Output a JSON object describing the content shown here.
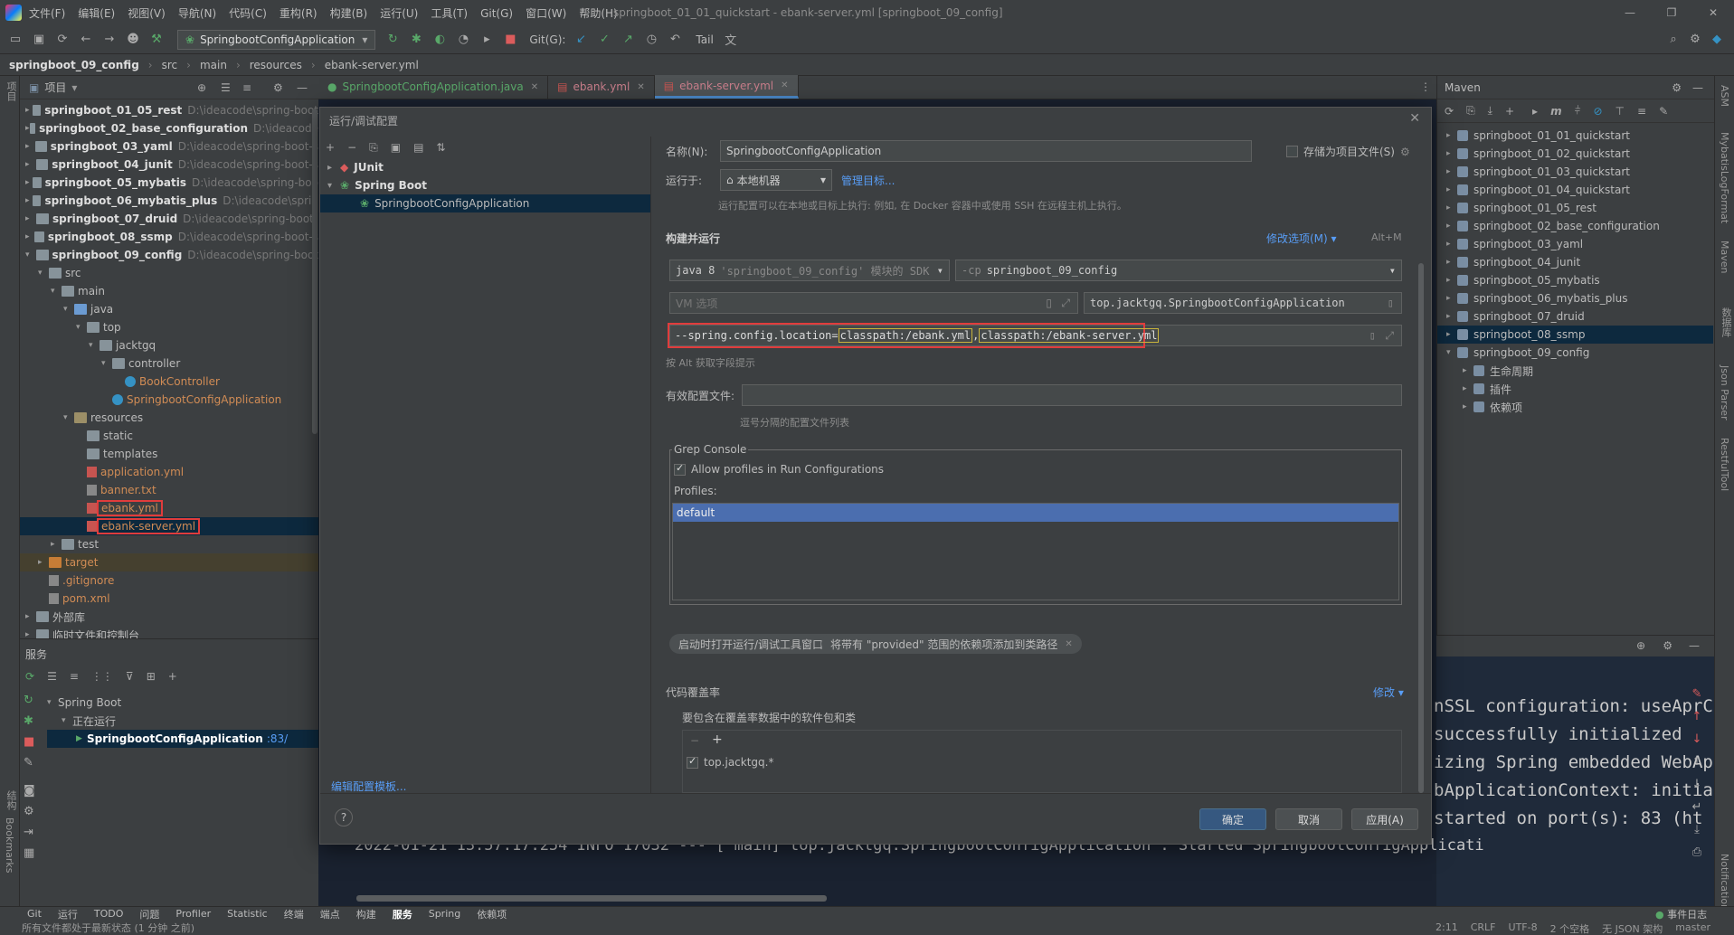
{
  "titlebar": {
    "menu": [
      "文件(F)",
      "编辑(E)",
      "视图(V)",
      "导航(N)",
      "代码(C)",
      "重构(R)",
      "构建(B)",
      "运行(U)",
      "工具(T)",
      "Git(G)",
      "窗口(W)",
      "帮助(H)"
    ],
    "window_title": "springboot_01_01_quickstart - ebank-server.yml [springboot_09_config]"
  },
  "toolbar": {
    "run_config": "SpringbootConfigApplication",
    "git_label": "Git(G):",
    "tail_label": "Tail"
  },
  "breadcrumb": [
    "springboot_09_config",
    "src",
    "main",
    "resources",
    "ebank-server.yml"
  ],
  "left_strip": {
    "project": "项目",
    "structure": "结构",
    "bookmarks": "Bookmarks"
  },
  "project": {
    "header": "项目",
    "tree": [
      {
        "indent": 0,
        "arrow": "▸",
        "icon": "folder",
        "name": "springboot_01_05_rest",
        "bold": true,
        "path": "D:\\ideacode\\spring-boot"
      },
      {
        "indent": 0,
        "arrow": "▸",
        "icon": "folder",
        "name": "springboot_02_base_configuration",
        "bold": true,
        "path": "D:\\ideacode"
      },
      {
        "indent": 0,
        "arrow": "▸",
        "icon": "folder",
        "name": "springboot_03_yaml",
        "bold": true,
        "path": "D:\\ideacode\\spring-boot-s"
      },
      {
        "indent": 0,
        "arrow": "▸",
        "icon": "folder",
        "name": "springboot_04_junit",
        "bold": true,
        "path": "D:\\ideacode\\spring-boot-s"
      },
      {
        "indent": 0,
        "arrow": "▸",
        "icon": "folder",
        "name": "springboot_05_mybatis",
        "bold": true,
        "path": "D:\\ideacode\\spring-boo"
      },
      {
        "indent": 0,
        "arrow": "▸",
        "icon": "folder",
        "name": "springboot_06_mybatis_plus",
        "bold": true,
        "path": "D:\\ideacode\\sprin"
      },
      {
        "indent": 0,
        "arrow": "▸",
        "icon": "folder",
        "name": "springboot_07_druid",
        "bold": true,
        "path": "D:\\ideacode\\spring-boot-"
      },
      {
        "indent": 0,
        "arrow": "▸",
        "icon": "folder",
        "name": "springboot_08_ssmp",
        "bold": true,
        "path": "D:\\ideacode\\spring-boot-s"
      },
      {
        "indent": 0,
        "arrow": "▾",
        "icon": "folder",
        "name": "springboot_09_config",
        "bold": true,
        "path": "D:\\ideacode\\spring-boot"
      },
      {
        "indent": 1,
        "arrow": "▾",
        "icon": "folder",
        "name": "src",
        "bold": false,
        "path": ""
      },
      {
        "indent": 2,
        "arrow": "▾",
        "icon": "folder",
        "name": "main",
        "bold": false,
        "path": ""
      },
      {
        "indent": 3,
        "arrow": "▾",
        "icon": "folder-src",
        "name": "java",
        "bold": false,
        "path": ""
      },
      {
        "indent": 4,
        "arrow": "▾",
        "icon": "folder",
        "name": "top",
        "bold": false,
        "path": ""
      },
      {
        "indent": 5,
        "arrow": "▾",
        "icon": "folder",
        "name": "jacktgq",
        "bold": false,
        "path": ""
      },
      {
        "indent": 6,
        "arrow": "▾",
        "icon": "folder",
        "name": "controller",
        "bold": false,
        "path": ""
      },
      {
        "indent": 7,
        "arrow": "",
        "icon": "class",
        "name": "BookController",
        "bold": false,
        "path": "",
        "color": "orange"
      },
      {
        "indent": 6,
        "arrow": "",
        "icon": "class",
        "name": "SpringbootConfigApplication",
        "bold": false,
        "path": "",
        "color": "orange"
      },
      {
        "indent": 3,
        "arrow": "▾",
        "icon": "folder-res",
        "name": "resources",
        "bold": false,
        "path": ""
      },
      {
        "indent": 4,
        "arrow": "",
        "icon": "folder",
        "name": "static",
        "bold": false,
        "path": ""
      },
      {
        "indent": 4,
        "arrow": "",
        "icon": "folder",
        "name": "templates",
        "bold": false,
        "path": ""
      },
      {
        "indent": 4,
        "arrow": "",
        "icon": "yml",
        "name": "application.yml",
        "bold": false,
        "path": "",
        "color": "orange"
      },
      {
        "indent": 4,
        "arrow": "",
        "icon": "file",
        "name": "banner.txt",
        "bold": false,
        "path": "",
        "color": "orange"
      },
      {
        "indent": 4,
        "arrow": "",
        "icon": "yml",
        "name": "ebank.yml",
        "bold": false,
        "path": "",
        "color": "orange",
        "boxed": true
      },
      {
        "indent": 4,
        "arrow": "",
        "icon": "yml",
        "name": "ebank-server.yml",
        "bold": false,
        "path": "",
        "color": "orange",
        "boxed": true,
        "selected": true
      },
      {
        "indent": 2,
        "arrow": "▸",
        "icon": "folder",
        "name": "test",
        "bold": false,
        "path": ""
      },
      {
        "indent": 1,
        "arrow": "▸",
        "icon": "folder-tgt",
        "name": "target",
        "bold": false,
        "path": "",
        "color": "orange",
        "shaded": true
      },
      {
        "indent": 1,
        "arrow": "",
        "icon": "file",
        "name": ".gitignore",
        "bold": false,
        "path": "",
        "color": "orange"
      },
      {
        "indent": 1,
        "arrow": "",
        "icon": "file",
        "name": "pom.xml",
        "bold": false,
        "path": "",
        "color": "orange"
      },
      {
        "indent": 0,
        "arrow": "▸",
        "icon": "folder",
        "name": "外部库",
        "bold": false,
        "path": ""
      },
      {
        "indent": 0,
        "arrow": "▸",
        "icon": "folder",
        "name": "临时文件和控制台",
        "bold": false,
        "path": ""
      }
    ]
  },
  "services": {
    "header": "服务",
    "tree": [
      {
        "indent": 0,
        "name": "Spring Boot"
      },
      {
        "indent": 1,
        "name": "正在运行"
      },
      {
        "indent": 2,
        "name": "SpringbootConfigApplication",
        "port": ":83/"
      }
    ]
  },
  "editor_tabs": [
    {
      "label": "SpringbootConfigApplication.java",
      "active": false
    },
    {
      "label": "ebank.yml",
      "active": false
    },
    {
      "label": "ebank-server.yml",
      "active": true
    }
  ],
  "console": {
    "lines": [
      "nSSL configuration: useAprC",
      " successfully initialized",
      "izing Spring embedded WebAp",
      "bApplicationContext: initia",
      "started on port(s): 83 (ht"
    ],
    "bottom_line": "2022-01-21 13:57:17.254  INFO 17032 --- [           main] top.jacktgq.SpringbootConfigApplication  : Started SpringbootConfigApplicati"
  },
  "maven": {
    "header": "Maven",
    "items": [
      {
        "indent": 0,
        "name": "springboot_01_01_quickstart"
      },
      {
        "indent": 0,
        "name": "springboot_01_02_quickstart"
      },
      {
        "indent": 0,
        "name": "springboot_01_03_quickstart"
      },
      {
        "indent": 0,
        "name": "springboot_01_04_quickstart"
      },
      {
        "indent": 0,
        "name": "springboot_01_05_rest"
      },
      {
        "indent": 0,
        "name": "springboot_02_base_configuration"
      },
      {
        "indent": 0,
        "name": "springboot_03_yaml"
      },
      {
        "indent": 0,
        "name": "springboot_04_junit"
      },
      {
        "indent": 0,
        "name": "springboot_05_mybatis"
      },
      {
        "indent": 0,
        "name": "springboot_06_mybatis_plus"
      },
      {
        "indent": 0,
        "name": "springboot_07_druid"
      },
      {
        "indent": 0,
        "name": "springboot_08_ssmp",
        "selected": true
      },
      {
        "indent": 0,
        "name": "springboot_09_config",
        "expanded": true
      },
      {
        "indent": 1,
        "name": "生命周期"
      },
      {
        "indent": 1,
        "name": "插件"
      },
      {
        "indent": 1,
        "name": "依赖项"
      }
    ]
  },
  "right_strip": [
    "ASM",
    "MybatisLogFormat",
    "Maven",
    "数据库",
    "Json Parser",
    "RestfulTool",
    "Notifications"
  ],
  "dialog": {
    "title": "运行/调试配置",
    "tree": [
      {
        "indent": 0,
        "arrow": "▸",
        "name": "JUnit",
        "bold": true
      },
      {
        "indent": 0,
        "arrow": "▾",
        "name": "Spring Boot",
        "bold": true
      },
      {
        "indent": 1,
        "arrow": "",
        "name": "SpringbootConfigApplication",
        "bold": false,
        "selected": true
      }
    ],
    "edit_templates": "编辑配置模板...",
    "name_label": "名称(N):",
    "name_value": "SpringbootConfigApplication",
    "store_label": "存储为项目文件(S)",
    "run_on_label": "运行于:",
    "run_on_value": "本地机器",
    "manage_targets": "管理目标...",
    "run_on_hint": "运行配置可以在本地或目标上执行: 例如, 在 Docker 容器中或使用 SSH 在远程主机上执行。",
    "build_run_label": "构建并运行",
    "modify_options": "修改选项(M)",
    "modify_shortcut": "Alt+M",
    "jdk_value": "java 8",
    "jdk_hint": "'springboot_09_config' 模块的 SDK",
    "cp_prefix": "-cp",
    "cp_value": "springboot_09_config",
    "vm_placeholder": "VM 选项",
    "main_class": "top.jacktgq.SpringbootConfigApplication",
    "args_prefix": "--spring.config.location=",
    "args_part1": "classpath:/ebank.yml",
    "args_comma": ",",
    "args_part2": "classpath:/ebank-server.yml",
    "alt_hint": "按 Alt 获取字段提示",
    "profiles_label": "有效配置文件:",
    "profiles_hint": "逗号分隔的配置文件列表",
    "grep_title": "Grep Console",
    "allow_profiles": "Allow profiles in Run Configurations",
    "profiles_list_label": "Profiles:",
    "profiles_list_item": "default",
    "chip1": "启动时打开运行/调试工具窗口",
    "chip2": "将带有 \"provided\" 范围的依赖项添加到类路径",
    "coverage_label": "代码覆盖率",
    "coverage_modify": "修改",
    "coverage_hint": "要包含在覆盖率数据中的软件包和类",
    "coverage_item": "top.jacktgq.*",
    "ok": "确定",
    "cancel": "取消",
    "apply": "应用(A)",
    "help": "?"
  },
  "toolstrip": [
    "Git",
    "运行",
    "TODO",
    "问题",
    "Profiler",
    "Statistic",
    "终端",
    "端点",
    "构建",
    "服务",
    "Spring",
    "依赖项"
  ],
  "toolstrip_right": "事件日志",
  "statusbar": {
    "message": "所有文件都处于最新状态 (1 分钟 之前)",
    "right": [
      "2:11",
      "CRLF",
      "UTF-8",
      "2 个空格",
      "无 JSON 架构",
      "master"
    ]
  },
  "colors": {
    "accent": "#4a88c7",
    "highlight_box": "#e03c3c",
    "yellow_box": "#c9b43c",
    "selection": "#0d293e",
    "profile_selected": "#4b6eaf"
  }
}
